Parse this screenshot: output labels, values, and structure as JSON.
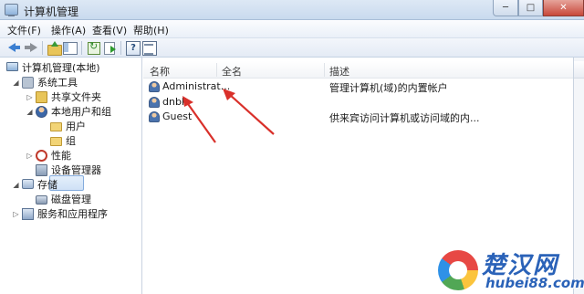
{
  "window": {
    "title": "计算机管理",
    "controls": {
      "minimize": "─",
      "maximize": "□",
      "close": "✕"
    }
  },
  "menu": [
    "文件(F)",
    "操作(A)",
    "查看(V)",
    "帮助(H)"
  ],
  "toolbar": {
    "icons": [
      "back-arrow-icon",
      "forward-arrow-icon",
      "up-folder-icon",
      "show-tree-icon",
      "refresh-icon",
      "export-list-icon",
      "help-icon",
      "properties-icon"
    ]
  },
  "tree": {
    "root": "计算机管理(本地)",
    "system_tools": "系统工具",
    "shared_folders": "共享文件夹",
    "local_users_groups": "本地用户和组",
    "users": "用户",
    "groups": "组",
    "performance": "性能",
    "device_manager": "设备管理器",
    "storage": "存储",
    "disk_management": "磁盘管理",
    "services_apps": "服务和应用程序",
    "expand_open": "◢",
    "expand_closed": "▷"
  },
  "list": {
    "columns": [
      "名称",
      "全名",
      "描述"
    ],
    "rows": [
      {
        "name": "Administrat...",
        "fullname": "",
        "description": "管理计算机(域)的内置帐户"
      },
      {
        "name": "dnbk",
        "fullname": "",
        "description": ""
      },
      {
        "name": "Guest",
        "fullname": "",
        "description": "供来宾访问计算机或访问域的内..."
      }
    ]
  },
  "annotation_color": "#d9302a",
  "watermark": {
    "name": "楚汉网",
    "url": "hubei88.com"
  }
}
